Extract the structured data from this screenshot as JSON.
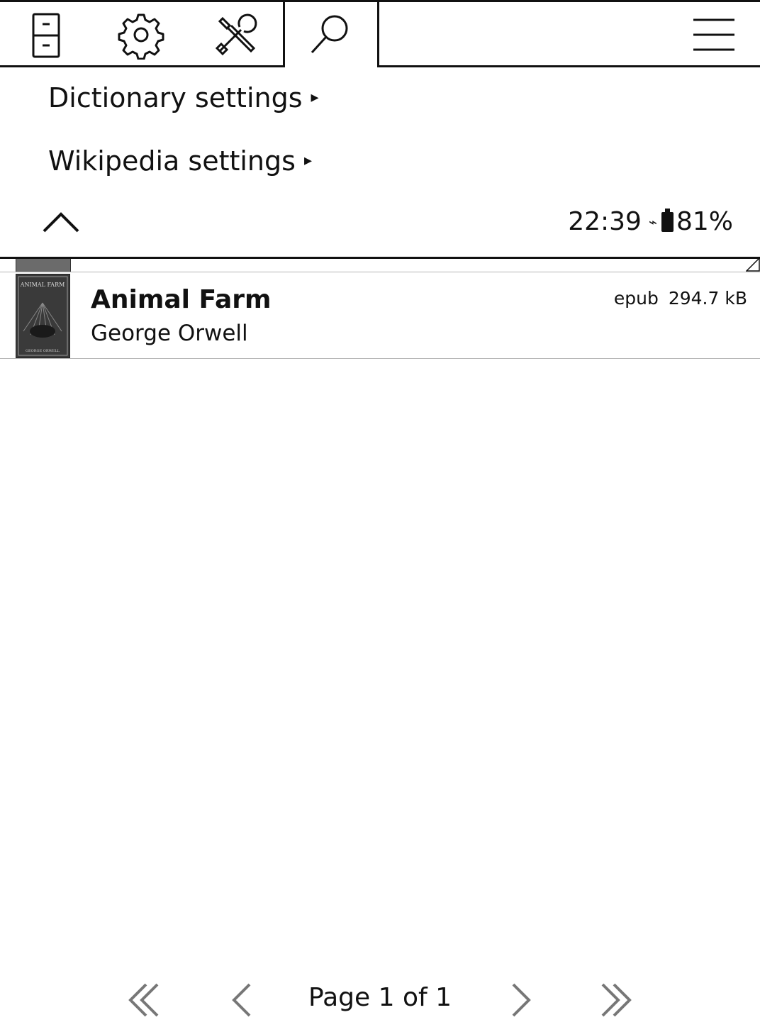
{
  "tabs": [
    {
      "name": "filing-cabinet-icon"
    },
    {
      "name": "gear-icon"
    },
    {
      "name": "tools-icon"
    },
    {
      "name": "search-icon",
      "active": true
    },
    {
      "name": "hamburger-menu-icon"
    }
  ],
  "menu": {
    "items": [
      {
        "label": "Dictionary settings",
        "arrow": "▸"
      },
      {
        "label": "Wikipedia settings",
        "arrow": "▸"
      }
    ],
    "collapse_icon": "chevron-up-icon"
  },
  "status": {
    "time": "22:39",
    "charging_symbol": "⌁",
    "battery_percent": "81%",
    "battery_level": 0.81
  },
  "books": [
    {
      "title": "Animal Farm",
      "author": "George Orwell",
      "format": "epub",
      "size": "294.7 kB",
      "cover_text": "ANIMAL FARM",
      "cover_author": "GEORGE ORWELL"
    }
  ],
  "footer": {
    "page_label": "Page 1 of 1",
    "first_icon": "double-chevron-left-icon",
    "prev_icon": "chevron-left-icon",
    "next_icon": "chevron-right-icon",
    "last_icon": "double-chevron-right-icon"
  },
  "colors": {
    "foreground": "#111111",
    "background": "#ffffff",
    "disabled_nav": "#777777"
  }
}
